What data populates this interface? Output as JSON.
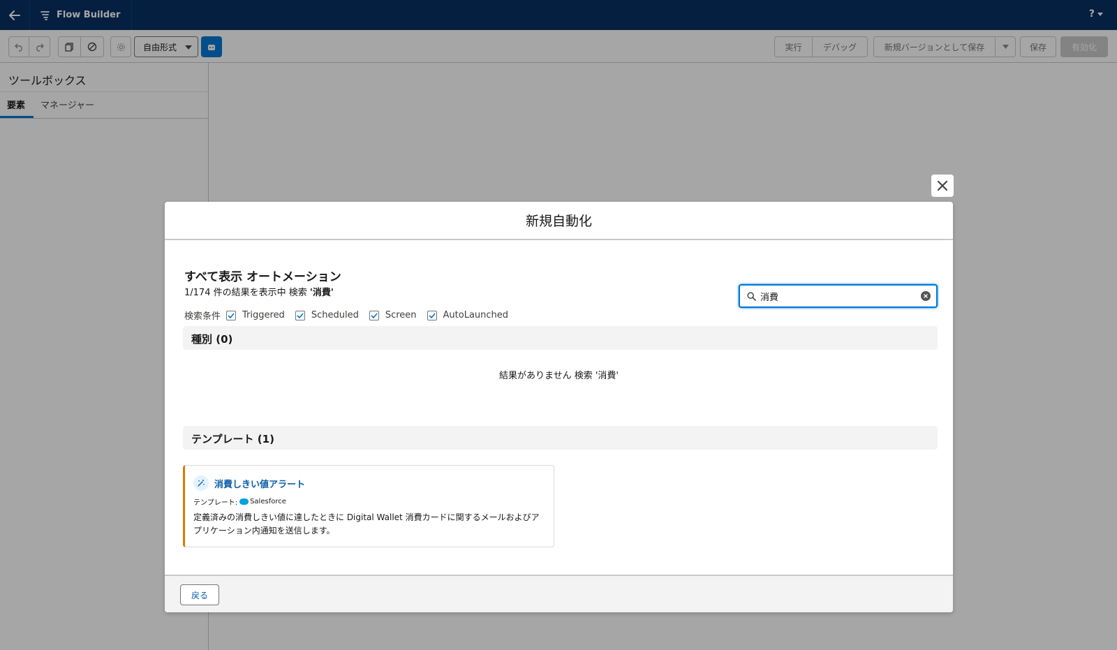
{
  "header": {
    "app_title": "Flow Builder",
    "help_label": "?"
  },
  "toolbar": {
    "layout_select_value": "自由形式",
    "run_label": "実行",
    "debug_label": "デバッグ",
    "save_as_new_version_label": "新規バージョンとして保存",
    "save_label": "保存",
    "activate_label": "有効化"
  },
  "toolbox": {
    "title": "ツールボックス",
    "tabs": [
      {
        "label": "要素",
        "active": true
      },
      {
        "label": "マネージャー",
        "active": false
      }
    ]
  },
  "modal": {
    "title": "新規自動化",
    "heading": "すべて表示 オートメーション",
    "summary_prefix": "1/174 件の結果を表示中 検索",
    "summary_term": "'消費'",
    "filter_label": "検索条件",
    "filters": [
      {
        "label": "Triggered",
        "checked": true
      },
      {
        "label": "Scheduled",
        "checked": true
      },
      {
        "label": "Screen",
        "checked": true
      },
      {
        "label": "AutoLaunched",
        "checked": true
      }
    ],
    "search": {
      "value": "消費",
      "placeholder": ""
    },
    "sections": {
      "types_title": "種別 (0)",
      "no_results": "結果がありません 検索 '消費'",
      "templates_title": "テンプレート (1)"
    },
    "template_card": {
      "title": "消費しきい値アラート",
      "meta_prefix": "テンプレート:",
      "meta_source": "Salesforce",
      "description": "定義済みの消費しきい値に達したときに Digital Wallet 消費カードに関するメールおよびアプリケーション内通知を送信します。"
    },
    "footer": {
      "back_label": "戻る"
    }
  },
  "colors": {
    "header_bg": "#032d60",
    "brand": "#0176d3",
    "link": "#0b5cab",
    "card_accent": "#dd7a01"
  }
}
